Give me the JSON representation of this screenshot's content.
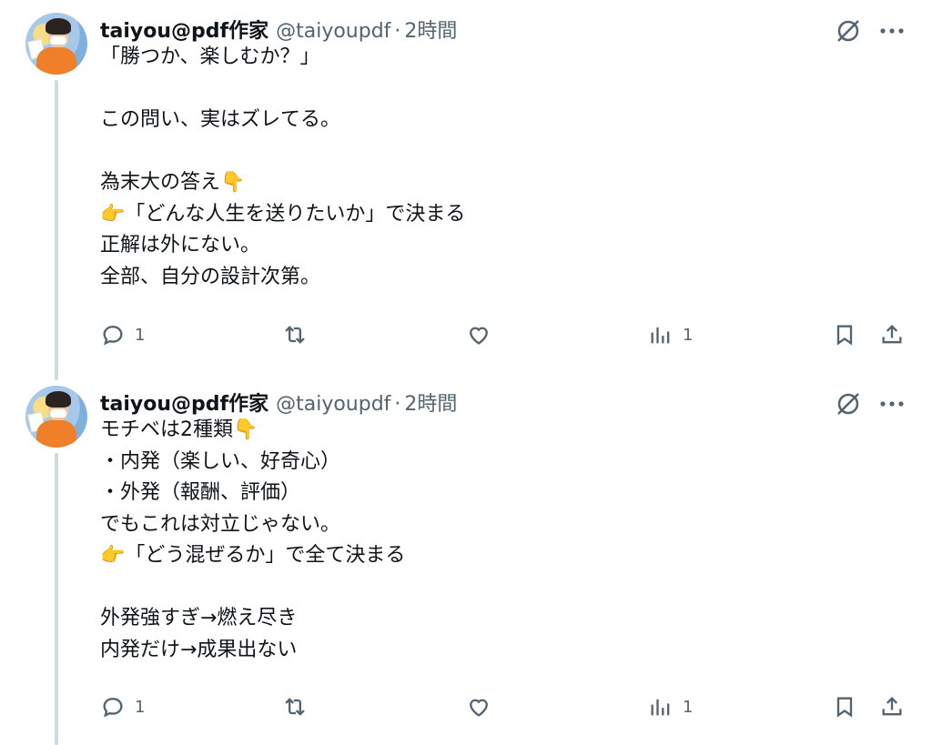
{
  "tweets": [
    {
      "author": {
        "name": "taiyou@pdf作家",
        "handle": "@taiyoupdf",
        "separator": "·",
        "time": "2時間"
      },
      "text": "「勝つか、楽しむか？」\n\nこの問い、実はズレてる。\n\n為末大の答え👇\n👉「どんな人生を送りたいか」で決まる\n正解は外にない。\n全部、自分の設計次第。",
      "stats": {
        "replies": "1",
        "retweets": "",
        "likes": "",
        "views": "1"
      }
    },
    {
      "author": {
        "name": "taiyou@pdf作家",
        "handle": "@taiyoupdf",
        "separator": "·",
        "time": "2時間"
      },
      "text": "モチベは2種類👇\n・内発（楽しい、好奇心）\n・外発（報酬、評価）\nでもこれは対立じゃない。\n👉「どう混ぜるか」で全て決まる\n\n外発強すぎ→燃え尽き\n内発だけ→成果出ない",
      "stats": {
        "replies": "1",
        "retweets": "",
        "likes": "",
        "views": "1"
      }
    }
  ],
  "icons": {
    "grok": "grok-icon",
    "more": "more-icon",
    "reply": "reply-icon",
    "retweet": "retweet-icon",
    "like": "heart-icon",
    "views": "views-icon",
    "bookmark": "bookmark-icon",
    "share": "share-icon"
  },
  "colors": {
    "text": "#0f1419",
    "secondary": "#536471",
    "thread_line": "#cfd9de",
    "background": "#ffffff"
  }
}
